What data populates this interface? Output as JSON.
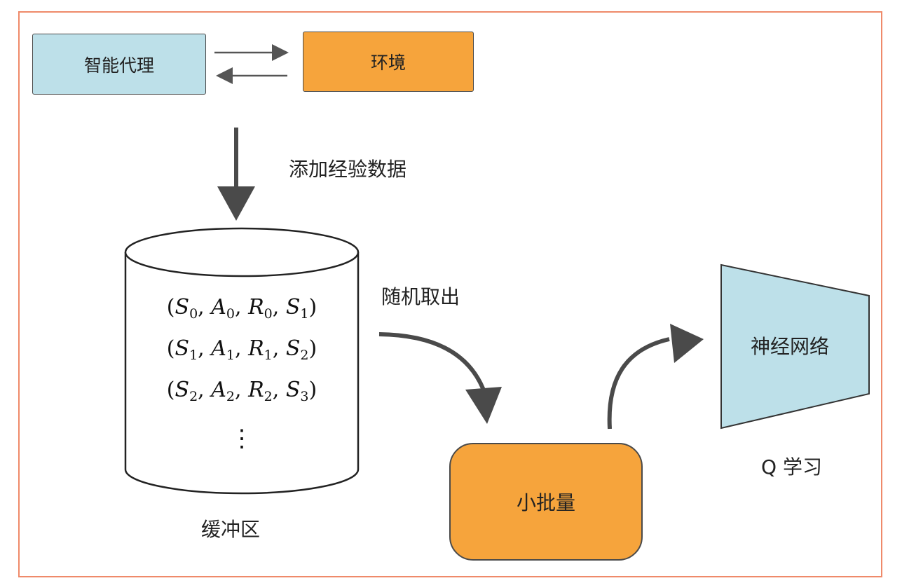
{
  "nodes": {
    "agent": "智能代理",
    "environment": "环境",
    "buffer_label": "缓冲区",
    "minibatch": "小批量",
    "network": "神经网络",
    "q_learning": "Q 学习"
  },
  "edges": {
    "add_experience": "添加经验数据",
    "random_sample": "随机取出"
  },
  "buffer_rows": [
    {
      "s": "0",
      "a": "0",
      "r": "0",
      "s2": "1"
    },
    {
      "s": "1",
      "a": "1",
      "r": "1",
      "s2": "2"
    },
    {
      "s": "2",
      "a": "2",
      "r": "2",
      "s2": "3"
    }
  ],
  "buffer_ellipsis": "⋮",
  "colors": {
    "agent_fill": "#bde0e9",
    "env_fill": "#f6a43c",
    "network_fill": "#bde0e9",
    "arrow": "#4a4a4a",
    "frame": "#ef8a6a"
  }
}
